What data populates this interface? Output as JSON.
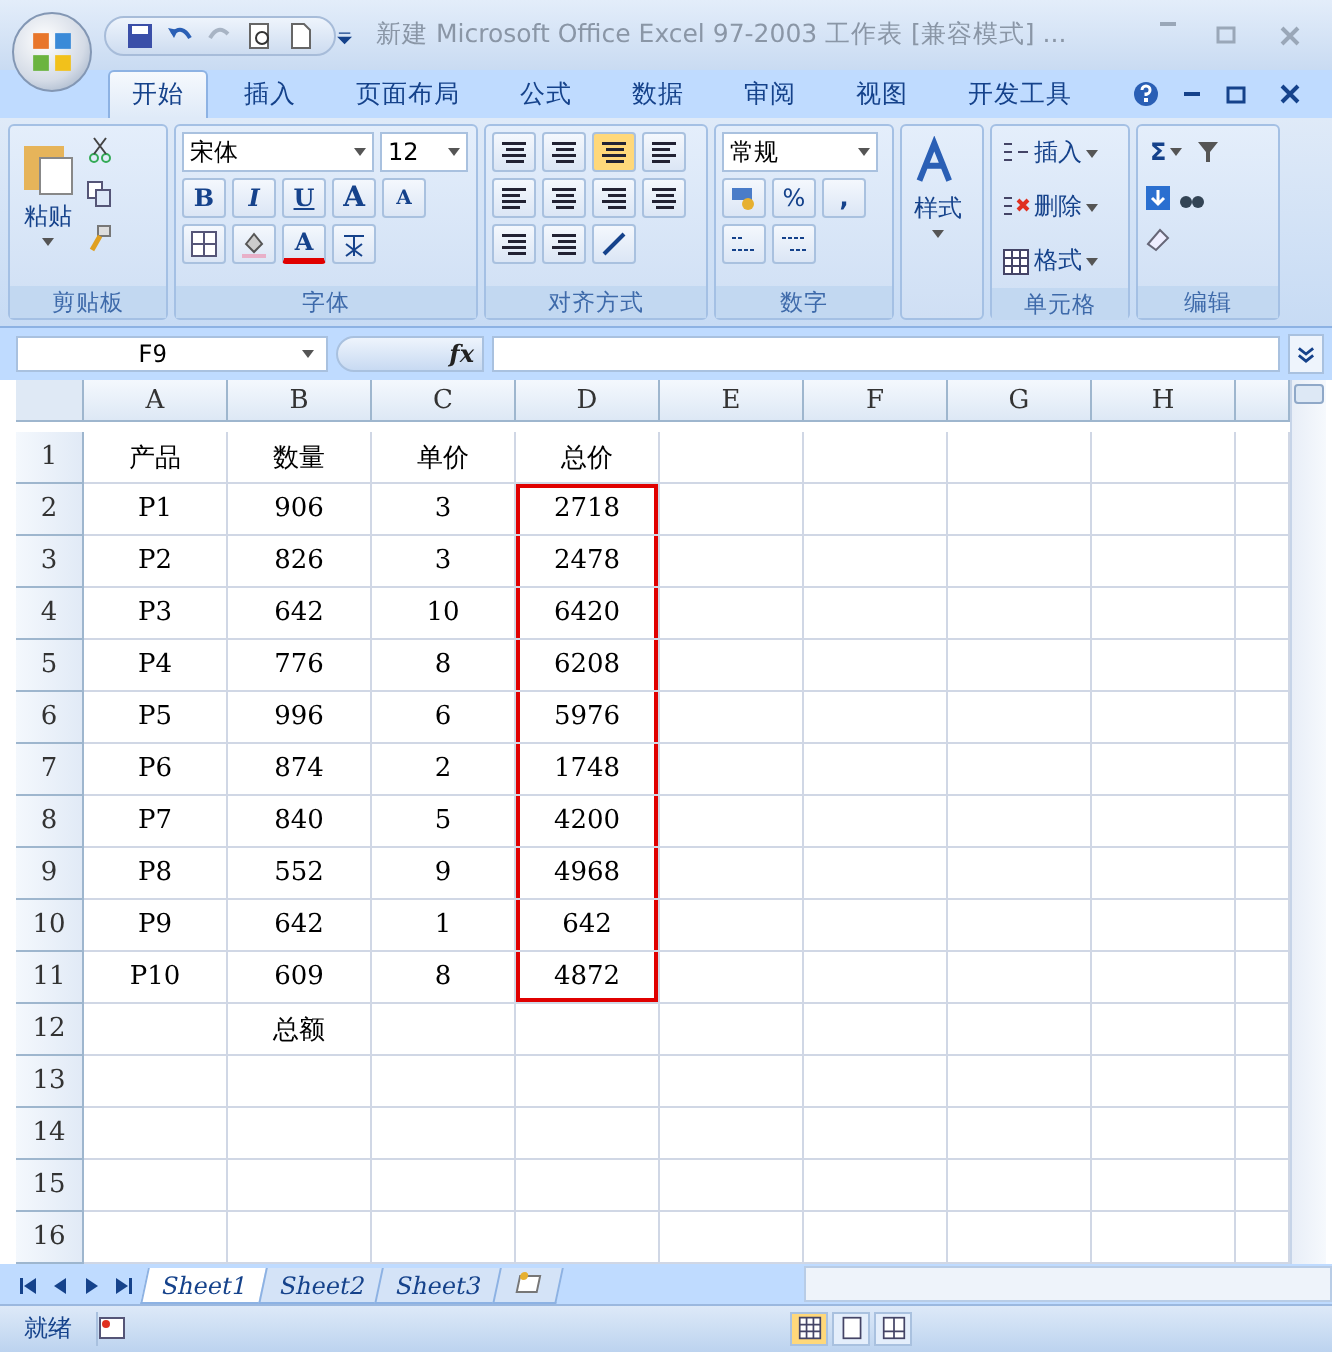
{
  "title_bar": {
    "title": "新建 Microsoft Office Excel 97-2003 工作表  [兼容模式] ..."
  },
  "ribbon_tabs": [
    {
      "label": "开始",
      "selected": true
    },
    {
      "label": "插入",
      "selected": false
    },
    {
      "label": "页面布局",
      "selected": false
    },
    {
      "label": "公式",
      "selected": false
    },
    {
      "label": "数据",
      "selected": false
    },
    {
      "label": "审阅",
      "selected": false
    },
    {
      "label": "视图",
      "selected": false
    },
    {
      "label": "开发工具",
      "selected": false
    }
  ],
  "clipboard": {
    "paste": "粘贴",
    "label": "剪贴板"
  },
  "font": {
    "name": "宋体",
    "size": "12",
    "bold": "B",
    "italic": "I",
    "underline": "U",
    "grow": "A",
    "shrink": "A",
    "color_letter": "A",
    "label": "字体"
  },
  "alignment": {
    "label": "对齐方式"
  },
  "number": {
    "format": "常规",
    "percent": "%",
    "comma": ",",
    "label": "数字"
  },
  "styles": {
    "label": "样式"
  },
  "cells": {
    "insert": "插入",
    "delete": "删除",
    "format": "格式",
    "label": "单元格"
  },
  "editing": {
    "sum": "Σ",
    "label": "编辑"
  },
  "formula_bar": {
    "name_box": "F9",
    "fx": "fx"
  },
  "columns": [
    {
      "label": "A",
      "boxed": false
    },
    {
      "label": "B",
      "boxed": false
    },
    {
      "label": "C",
      "boxed": false
    },
    {
      "label": "D",
      "boxed": true
    },
    {
      "label": "E",
      "boxed": false
    },
    {
      "label": "F",
      "boxed": false
    },
    {
      "label": "G",
      "boxed": false
    },
    {
      "label": "H",
      "boxed": false
    }
  ],
  "rows": [
    {
      "number": "1",
      "cells": [
        "产品",
        "数量",
        "单价",
        "总价"
      ],
      "boxed": false
    },
    {
      "number": "2",
      "cells": [
        "P1",
        "906",
        "3",
        "2718"
      ],
      "boxed": true
    },
    {
      "number": "3",
      "cells": [
        "P2",
        "826",
        "3",
        "2478"
      ],
      "boxed": true
    },
    {
      "number": "4",
      "cells": [
        "P3",
        "642",
        "10",
        "6420"
      ],
      "boxed": true
    },
    {
      "number": "5",
      "cells": [
        "P4",
        "776",
        "8",
        "6208"
      ],
      "boxed": true
    },
    {
      "number": "6",
      "cells": [
        "P5",
        "996",
        "6",
        "5976"
      ],
      "boxed": true
    },
    {
      "number": "7",
      "cells": [
        "P6",
        "874",
        "2",
        "1748"
      ],
      "boxed": true
    },
    {
      "number": "8",
      "cells": [
        "P7",
        "840",
        "5",
        "4200"
      ],
      "boxed": true
    },
    {
      "number": "9",
      "cells": [
        "P8",
        "552",
        "9",
        "4968"
      ],
      "boxed": true
    },
    {
      "number": "10",
      "cells": [
        "P9",
        "642",
        "1",
        "642"
      ],
      "boxed": true
    },
    {
      "number": "11",
      "cells": [
        "P10",
        "609",
        "8",
        "4872"
      ],
      "boxed": true
    },
    {
      "number": "12",
      "cells": [
        null,
        "总额"
      ],
      "boxed": false
    },
    {
      "number": "13",
      "cells": [],
      "boxed": false
    },
    {
      "number": "14",
      "cells": [],
      "boxed": false
    },
    {
      "number": "15",
      "cells": [],
      "boxed": false
    },
    {
      "number": "16",
      "cells": [],
      "boxed": false
    }
  ],
  "sheet_tabs": [
    {
      "label": "Sheet1",
      "selected": true
    },
    {
      "label": "Sheet2",
      "selected": false
    },
    {
      "label": "Sheet3",
      "selected": false
    }
  ],
  "status_bar": {
    "text": "就绪",
    "views": [
      {
        "kind": "normal",
        "selected": true
      },
      {
        "kind": "layout",
        "selected": false
      },
      {
        "kind": "break",
        "selected": false
      }
    ]
  }
}
